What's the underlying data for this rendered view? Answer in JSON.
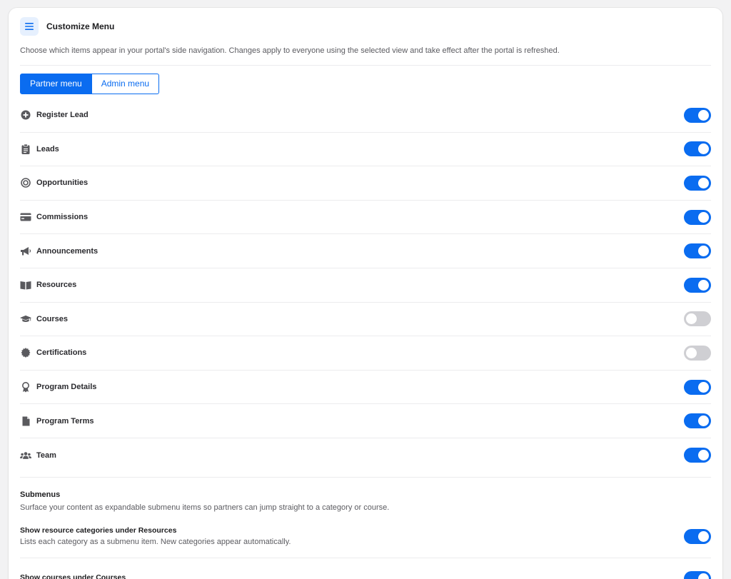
{
  "header": {
    "title": "Customize Menu",
    "icon": "menu-icon",
    "description": "Choose which items appear in your portal's side navigation. Changes apply to everyone using the selected view and take effect after the portal is refreshed."
  },
  "tabs": {
    "partner": "Partner menu",
    "admin": "Admin menu",
    "selected": "partner"
  },
  "menu_items": [
    {
      "label": "Register Lead",
      "icon": "plus-circle-icon",
      "enabled": true
    },
    {
      "label": "Leads",
      "icon": "clipboard-icon",
      "enabled": true
    },
    {
      "label": "Opportunities",
      "icon": "target-icon",
      "enabled": true
    },
    {
      "label": "Commissions",
      "icon": "credit-card-icon",
      "enabled": true
    },
    {
      "label": "Announcements",
      "icon": "megaphone-icon",
      "enabled": true
    },
    {
      "label": "Resources",
      "icon": "book-icon",
      "enabled": true
    },
    {
      "label": "Courses",
      "icon": "graduation-cap-icon",
      "enabled": false
    },
    {
      "label": "Certifications",
      "icon": "certificate-badge-icon",
      "enabled": false
    },
    {
      "label": "Program Details",
      "icon": "award-ribbon-icon",
      "enabled": true
    },
    {
      "label": "Program Terms",
      "icon": "document-icon",
      "enabled": true
    },
    {
      "label": "Team",
      "icon": "users-icon",
      "enabled": true
    }
  ],
  "submenus": {
    "title": "Submenus",
    "description": "Surface your content as expandable submenu items so partners can jump straight to a category or course.",
    "items": [
      {
        "title": "Show resource categories under Resources",
        "description": "Lists each category as a submenu item. New categories appear automatically.",
        "enabled": true
      },
      {
        "title": "Show courses under Courses",
        "description": "",
        "enabled": true
      }
    ]
  },
  "colors": {
    "accent": "#0a6cf0",
    "toggle_off": "#cfcfd3",
    "icon": "#5a5a5e"
  }
}
